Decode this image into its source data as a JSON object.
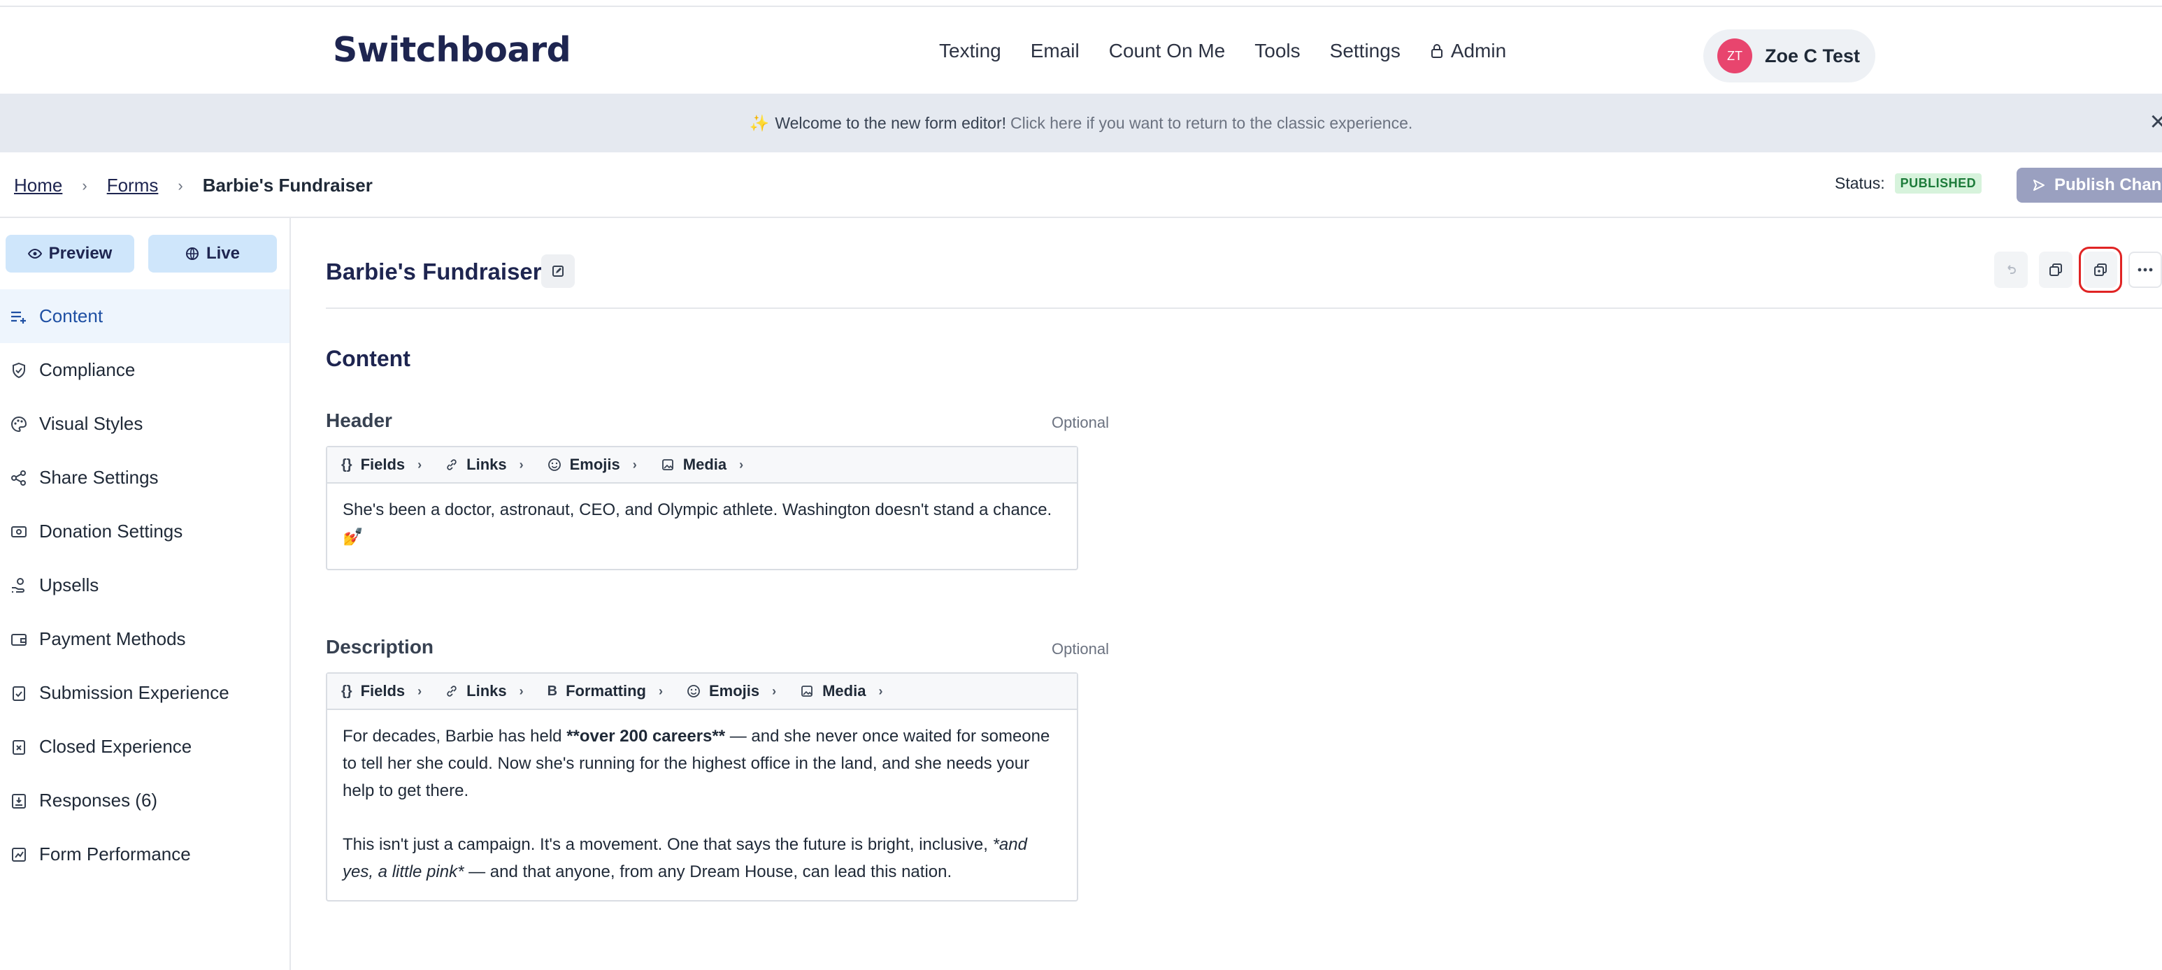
{
  "brand": {
    "logo": "Switchboard"
  },
  "nav": {
    "links": [
      "Texting",
      "Email",
      "Count On Me",
      "Tools",
      "Settings"
    ],
    "admin": "Admin",
    "user_initials": "ZT",
    "user_name": "Zoe C Test"
  },
  "banner": {
    "spark": "✨",
    "welcome": "Welcome to the new form editor!",
    "link": "Click here if you want to return to the classic experience.",
    "close": "×"
  },
  "breadcrumb": {
    "home": "Home",
    "forms": "Forms",
    "current": "Barbie's Fundraiser",
    "sep": "›"
  },
  "status": {
    "label": "Status:",
    "value": "PUBLISHED"
  },
  "publish_label": "Publish Changes",
  "sidebar": {
    "preview": "Preview",
    "live": "Live",
    "items": [
      {
        "label": "Content",
        "icon": "content-icon",
        "active": true
      },
      {
        "label": "Compliance",
        "icon": "shield-check-icon"
      },
      {
        "label": "Visual Styles",
        "icon": "palette-icon"
      },
      {
        "label": "Share Settings",
        "icon": "share-icon"
      },
      {
        "label": "Donation Settings",
        "icon": "cash-icon"
      },
      {
        "label": "Upsells",
        "icon": "hand-coin-icon"
      },
      {
        "label": "Payment Methods",
        "icon": "wallet-icon"
      },
      {
        "label": "Submission Experience",
        "icon": "clipboard-check-icon"
      },
      {
        "label": "Closed Experience",
        "icon": "clipboard-x-icon"
      },
      {
        "label": "Responses (6)",
        "icon": "inbox-icon"
      },
      {
        "label": "Form Performance",
        "icon": "chart-icon"
      }
    ]
  },
  "main": {
    "form_title": "Barbie's Fundraiser",
    "section_title": "Content",
    "header": {
      "label": "Header",
      "optional": "Optional",
      "toolbar": [
        "Fields",
        "Links",
        "Emojis",
        "Media"
      ],
      "text": "She's been a doctor, astronaut, CEO, and Olympic athlete. Washington doesn't stand a chance. 💅"
    },
    "description": {
      "label": "Description",
      "optional": "Optional",
      "toolbar": [
        "Fields",
        "Links",
        "Formatting",
        "Emojis",
        "Media"
      ],
      "p1_a": "For decades, Barbie has held ",
      "p1_bold": "**over 200 careers**",
      "p1_b": " — and she never once waited for someone to tell her she could. Now she's running for the highest office in the land, and she needs your help to get there.",
      "p2_a": "This isn't just a campaign. It's a movement. One that says the future is bright, inclusive, ",
      "p2_italic": "*and yes, a little pink*",
      "p2_b": " — and that anyone, from any Dream House, can lead this nation."
    }
  },
  "colors": {
    "brand_navy": "#1e2550",
    "published_bg": "#d7f3dc",
    "published_fg": "#1d7b3a",
    "avatar": "#e8456e",
    "highlight": "#e02424"
  }
}
